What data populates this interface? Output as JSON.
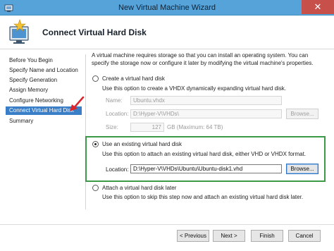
{
  "window": {
    "title": "New Virtual Machine Wizard",
    "close_glyph": "✕",
    "icon": "wizard-app-icon"
  },
  "header": {
    "title": "Connect Virtual Hard Disk",
    "icon": "virtual-machine-wizard-icon"
  },
  "sidebar": {
    "items": [
      {
        "label": "Before You Begin",
        "active": false
      },
      {
        "label": "Specify Name and Location",
        "active": false
      },
      {
        "label": "Specify Generation",
        "active": false
      },
      {
        "label": "Assign Memory",
        "active": false
      },
      {
        "label": "Configure Networking",
        "active": false
      },
      {
        "label": "Connect Virtual Hard Disk",
        "active": true
      },
      {
        "label": "Summary",
        "active": false
      }
    ],
    "annotation_arrow_color": "#d9262c"
  },
  "content": {
    "description": "A virtual machine requires storage so that you can install an operating system. You can specify the storage now or configure it later by modifying the virtual machine's properties.",
    "create": {
      "label": "Create a virtual hard disk",
      "help": "Use this option to create a VHDX dynamically expanding virtual hard disk.",
      "name_label": "Name:",
      "name_value": "Ubuntu.vhdx",
      "location_label": "Location:",
      "location_value": "D:\\Hyper-V\\VHDs\\",
      "browse_label": "Browse...",
      "size_label": "Size:",
      "size_value": "127",
      "size_unit": "GB (Maximum: 64 TB)",
      "selected": false
    },
    "existing": {
      "label": "Use an existing virtual hard disk",
      "help": "Use this option to attach an existing virtual hard disk, either VHD or VHDX format.",
      "location_label": "Location:",
      "location_value": "D:\\Hyper-V\\VHDs\\Ubuntu\\Ubuntu-disk1.vhd",
      "browse_label": "Browse...",
      "selected": true,
      "highlight_color": "#3b9a46"
    },
    "later": {
      "label": "Attach a virtual hard disk later",
      "help": "Use this option to skip this step now and attach an existing virtual hard disk later.",
      "selected": false
    }
  },
  "footer": {
    "previous_label": "< Previous",
    "next_label": "Next >",
    "finish_label": "Finish",
    "cancel_label": "Cancel"
  }
}
